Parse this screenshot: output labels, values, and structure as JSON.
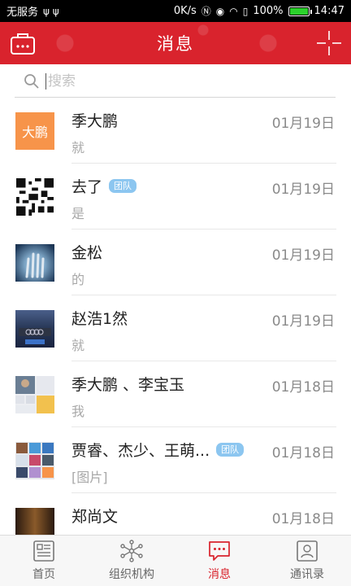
{
  "status_bar": {
    "carrier": "无服务",
    "net_speed": "0K/s",
    "battery_pct": "100%",
    "time": "14:47"
  },
  "header": {
    "title": "消息"
  },
  "search": {
    "placeholder": "搜索"
  },
  "conversations": [
    {
      "name": "季大鹏",
      "avatar_text": "大鹏",
      "date": "01月19日",
      "preview": "就",
      "badge": ""
    },
    {
      "name": "去了",
      "avatar_text": "",
      "date": "01月19日",
      "preview": "是",
      "badge": "团队"
    },
    {
      "name": "金松",
      "avatar_text": "",
      "date": "01月19日",
      "preview": "的",
      "badge": ""
    },
    {
      "name": "赵浩1然",
      "avatar_text": "",
      "date": "01月19日",
      "preview": "就",
      "badge": ""
    },
    {
      "name": "季大鹏 、李宝玉",
      "avatar_text": "",
      "date": "01月18日",
      "preview": "我",
      "badge": ""
    },
    {
      "name": "贾睿、杰少、王萌...",
      "avatar_text": "",
      "date": "01月18日",
      "preview": "[图片]",
      "badge": "团队"
    },
    {
      "name": "郑尚文",
      "avatar_text": "",
      "date": "01月18日",
      "preview": "",
      "badge": ""
    }
  ],
  "bottom_nav": [
    {
      "label": "首页",
      "icon": "home-icon"
    },
    {
      "label": "组织机构",
      "icon": "org-icon"
    },
    {
      "label": "消息",
      "icon": "message-icon",
      "active": true
    },
    {
      "label": "通讯录",
      "icon": "contacts-icon"
    }
  ],
  "colors": {
    "accent": "#d9232d",
    "badge": "#8cc6f0",
    "avatar_orange": "#f7944a"
  }
}
